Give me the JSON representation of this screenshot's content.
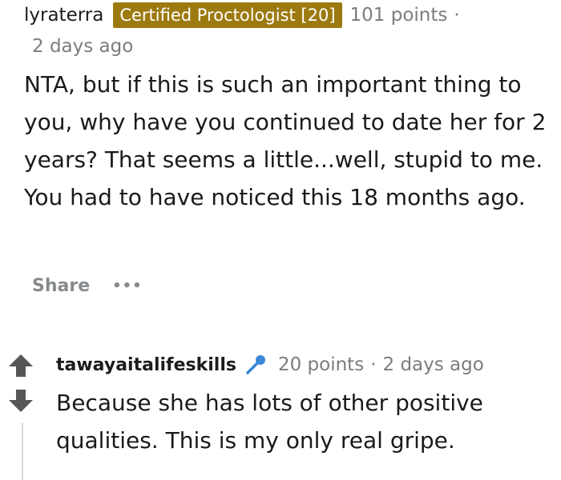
{
  "comment": {
    "username": "lyraterra",
    "flair": "Certified Proctologist [20]",
    "points": "101 points",
    "separator": "·",
    "timestamp": "2 days ago",
    "body": "NTA, but if this is such an important thing to you, why have you continued to date her for 2 years? That seems a little...well, stupid to me. You had to have noticed this 18 months ago.",
    "share_label": "Share",
    "more_label": "•••"
  },
  "reply": {
    "username": "tawayaitalifeskills",
    "icon": "microphone-icon",
    "points": "20 points",
    "separator": "·",
    "timestamp": "2 days ago",
    "body": "Because she has lots of other positive qualities. This is my only real gripe."
  },
  "colors": {
    "flair_bg": "#9c7a10",
    "muted_text": "#7c7c7c",
    "vote_arrow": "#565656",
    "mic_blue": "#3a86d8"
  }
}
